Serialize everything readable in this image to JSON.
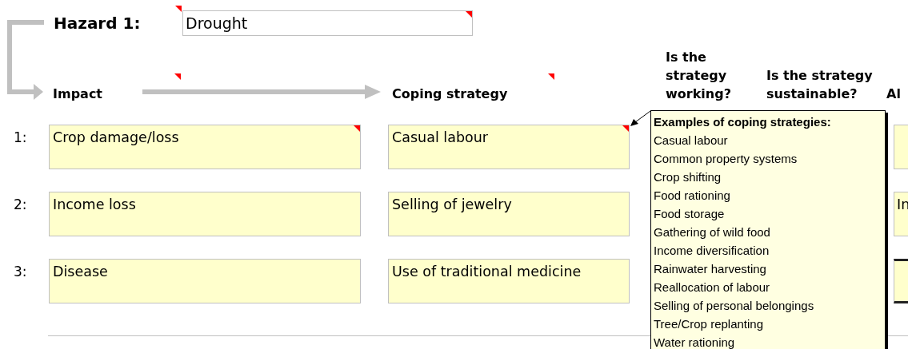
{
  "hazard": {
    "label": "Hazard 1:",
    "label_comment": true,
    "value": "Drought",
    "value_comment": true
  },
  "headers": [
    {
      "kind": "impact",
      "text": "Impact",
      "comment": true
    },
    {
      "kind": "coping",
      "text": "Coping strategy",
      "comment": true
    },
    {
      "kind": "working",
      "text": "Is the strategy working?",
      "comment": false
    },
    {
      "kind": "sustainable",
      "text": "Is the strategy sustainable?",
      "comment": false
    },
    {
      "kind": "column_5",
      "text": "Al",
      "comment": false
    }
  ],
  "rows": [
    {
      "number": "1:",
      "impact": "Crop damage/loss",
      "impact_comment": true,
      "coping": "Casual labour",
      "coping_comment": true,
      "column_5_selected": false
    },
    {
      "number": "2:",
      "impact": "Income loss",
      "impact_comment": false,
      "coping": "Selling of jewelry",
      "coping_comment": false,
      "column_5": "In",
      "column_5_selected": false
    },
    {
      "number": "3:",
      "impact": "Disease",
      "impact_comment": false,
      "coping": "Use of traditional medicine",
      "coping_comment": false,
      "column_5_selected": true
    }
  ],
  "comment_popup": {
    "title": "Examples of coping strategies:",
    "items": [
      "Casual labour",
      "Common property systems",
      "Crop shifting",
      "Food rationing",
      "Food storage",
      "Gathering of wild food",
      "Income diversification",
      "Rainwater harvesting",
      "Reallocation of labour",
      "Selling of personal belongings",
      "Tree/Crop replanting",
      "Water rationing"
    ]
  }
}
